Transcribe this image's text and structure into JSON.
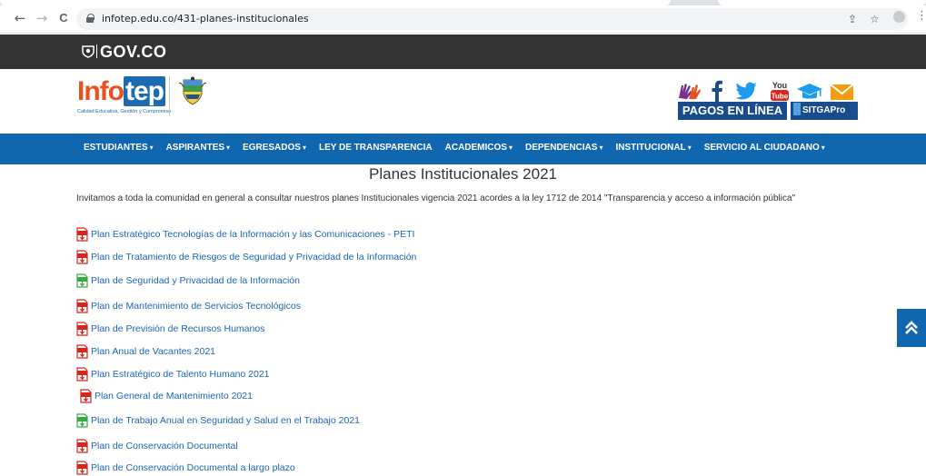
{
  "browser": {
    "url": "infotep.edu.co/431-planes-institucionales",
    "back": "←",
    "forward": "→",
    "reload": "C",
    "share": "⇪",
    "star": "☆",
    "menu": "⋮"
  },
  "gov": {
    "brand": "GOV.CO"
  },
  "header": {
    "logo_info": "Info",
    "logo_tep": "tep",
    "logo_tagline": "Calidad Educativa, Gestión y Compromiso",
    "pagos_label": "PAGOS EN LÍNEA",
    "sitga_label": "SITGAPro",
    "youtube_top": "You",
    "youtube_bottom": "Tube"
  },
  "nav": {
    "items": [
      {
        "label": "ESTUDIANTES",
        "caret": "▾"
      },
      {
        "label": "ASPIRANTES",
        "caret": "▾"
      },
      {
        "label": "EGRESADOS",
        "caret": "▾"
      },
      {
        "label": "LEY DE TRANSPARENCIA",
        "caret": ""
      },
      {
        "label": "ACADEMICOS",
        "caret": "▾"
      },
      {
        "label": "DEPENDENCIAS",
        "caret": "▾"
      },
      {
        "label": "INSTITUCIONAL",
        "caret": "▾"
      },
      {
        "label": "SERVICIO AL CIUDADANO",
        "caret": "▾"
      }
    ]
  },
  "content": {
    "title": "Planes Institucionales 2021",
    "intro": "Invitamos a toda la comunidad en general a consultar nuestros planes Institucionales vigencia 2021 acordes a la ley 1712 de 2014 \"Transparencia y acceso a información pública\"",
    "documents": [
      {
        "label": "Plan Estratégico Tecnologías de la Información y las Comunicaciones - PETI",
        "type": "pdf"
      },
      {
        "label": "Plan de Tratamiento de Riesgos de Seguridad y Privacidad de la Información",
        "type": "pdf"
      },
      {
        "label": "Plan de Seguridad y Privacidad de la Información",
        "type": "xls"
      },
      {
        "label": "Plan de Mantenimiento de Servicios Tecnológicos",
        "type": "pdf"
      },
      {
        "label": "Plan de Previsión de Recursos Humanos",
        "type": "pdf"
      },
      {
        "label": "Plan Anual de Vacantes 2021",
        "type": "pdf"
      },
      {
        "label": "Plan Estratégico de Talento Humano 2021",
        "type": "pdf"
      },
      {
        "label": "Plan General de Mantenimiento 2021",
        "type": "pdf"
      },
      {
        "label": "Plan de Trabajo Anual en Seguridad y Salud en el Trabajo 2021",
        "type": "xls"
      },
      {
        "label": "Plan de Conservación Documental",
        "type": "pdf"
      },
      {
        "label": "Plan de Conservación Documental a largo plazo",
        "type": "pdf"
      }
    ]
  },
  "scroll_top_glyph": "⌃",
  "colors": {
    "nav_blue": "#1166b0",
    "gov_bar": "#333333",
    "link_blue": "#1a65b3",
    "pdf_red": "#d9261c",
    "xls_green": "#3aa845",
    "brand_orange": "#e8501e"
  }
}
